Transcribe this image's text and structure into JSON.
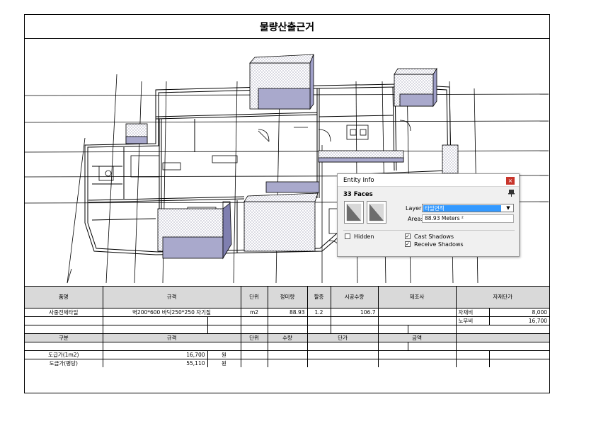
{
  "title": "물량산출근거",
  "entity_info": {
    "title": "Entity Info",
    "close_glyph": "×",
    "faces": "33 Faces",
    "layer_label": "Layer:",
    "layer_value": "타일면적",
    "area_label": "Area:",
    "area_value": "88.93 Meters ²",
    "hidden_label": "Hidden",
    "hidden_checked": false,
    "cast_shadows_label": "Cast Shadows",
    "cast_shadows_checked": true,
    "receive_shadows_label": "Receive Shadows",
    "receive_shadows_checked": true,
    "check_glyph": "✓"
  },
  "table": {
    "header1": {
      "name": "품명",
      "spec": "규격",
      "unit": "단위",
      "net_qty": "정미량",
      "surcharge": "할증",
      "work_qty": "시공수량",
      "maker": "제조사",
      "unit_price": "자재단가"
    },
    "row1": {
      "name": "사중전체타일",
      "spec": "벽200*600 바닥250*250 자기질",
      "unit": "m2",
      "net_qty": "88.93",
      "surcharge": "1.2",
      "work_qty": "106.7",
      "cost_label": "자재비",
      "cost_value": "8,000"
    },
    "row2": {
      "cost_label": "노무비",
      "cost_value": "16,700"
    },
    "header2": {
      "category": "구분",
      "spec": "규격",
      "unit": "단위",
      "qty": "수량",
      "price": "단가",
      "amount": "금액"
    },
    "row5": {
      "label": "도급가(1m2)",
      "value": "16,700",
      "currency": "원"
    },
    "row6": {
      "label": "도급가(평당)",
      "value": "55,110",
      "currency": "원"
    }
  }
}
